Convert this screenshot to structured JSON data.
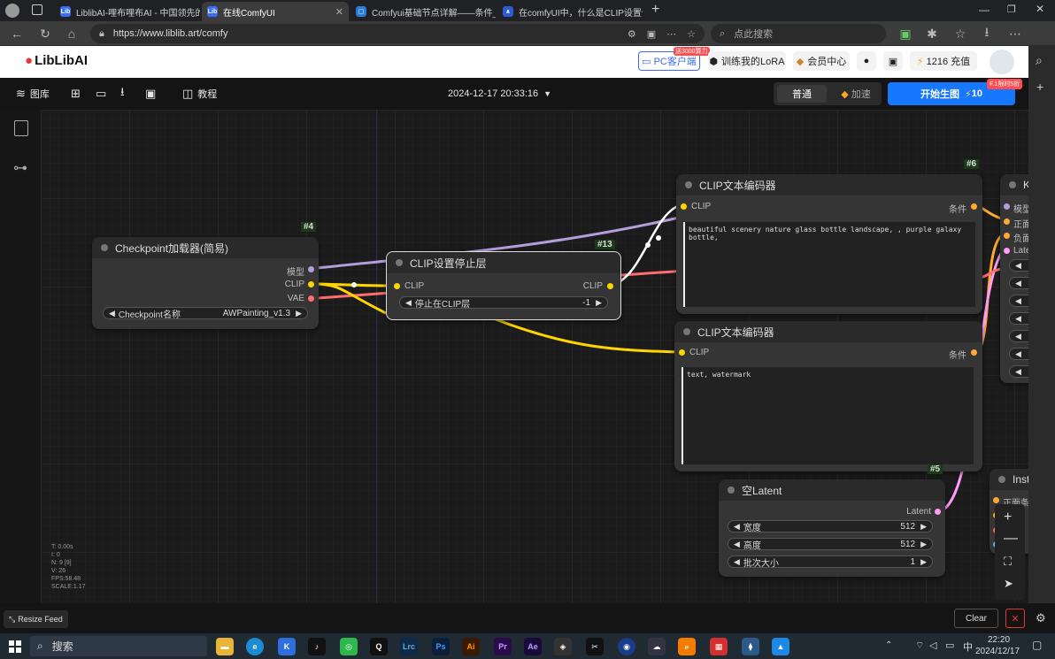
{
  "browser": {
    "tabs": [
      {
        "label": "LiblibAI-哩布哩布AI - 中国领先的"
      },
      {
        "label": "在线ComfyUI"
      },
      {
        "label": "Comfyui基础节点详解——条件_"
      },
      {
        "label": "在comfyUI中，什么是CLIP设置停"
      }
    ],
    "url": "https://www.liblib.art/comfy",
    "search_placeholder": "点此搜索",
    "new_tab": "+"
  },
  "site_header": {
    "logo": "LibLibAI",
    "pc_client": "PC客户端",
    "pc_client_badge": "送3000算力",
    "train_lora": "训练我的LoRA",
    "vip": "会员中心",
    "credits": "1216 充值"
  },
  "toolbar": {
    "gallery": "图库",
    "tutorial": "教程",
    "timestamp": "2024-12-17 20:33:16",
    "mode_normal": "普通",
    "mode_fast": "加速",
    "generate": "开始生图",
    "generate_cost": "10",
    "discount_badge": "F.1限时5折"
  },
  "nodes": {
    "checkpoint": {
      "id": "#4",
      "title": "Checkpoint加载器(简易)",
      "out_model": "模型",
      "out_clip": "CLIP",
      "out_vae": "VAE",
      "widget_label": "Checkpoint名称",
      "widget_value": "AWPainting_v1.3"
    },
    "clip_skip": {
      "id": "#13",
      "title": "CLIP设置停止层",
      "in_clip": "CLIP",
      "out_clip": "CLIP",
      "widget_label": "停止在CLIP层",
      "widget_value": "-1"
    },
    "clip_pos": {
      "id": "#6",
      "title": "CLIP文本编码器",
      "in_clip": "CLIP",
      "out_cond": "条件",
      "text": "beautiful scenery nature glass bottle landscape, , purple galaxy bottle,"
    },
    "clip_neg": {
      "title": "CLIP文本编码器",
      "in_clip": "CLIP",
      "out_cond": "条件",
      "text": "text, watermark"
    },
    "empty_latent": {
      "id": "#5",
      "title": "空Latent",
      "out_latent": "Latent",
      "w_label": "宽度",
      "w_value": "512",
      "h_label": "高度",
      "h_value": "512",
      "b_label": "批次大小",
      "b_value": "1"
    },
    "ksampler": {
      "title": "K",
      "in_model": "模型",
      "in_pos": "正面",
      "in_neg": "负面",
      "in_latent": "Late"
    },
    "instance": {
      "title": "Insta",
      "in_pos": "正面条",
      "in_2": "条"
    }
  },
  "stats": {
    "t": "T: 0.00s",
    "i": "I: 0",
    "n": "N: 9 [9]",
    "v": "V: 26",
    "fps": "FPS:58.48",
    "scale": "SCALE:1.17"
  },
  "bottom": {
    "resize_feed": "Resize Feed",
    "clear": "Clear"
  },
  "taskbar": {
    "search": "搜索",
    "time": "22:20",
    "date": "2024/12/17",
    "lang": "中"
  },
  "colors": {
    "model_wire": "#b39ddb",
    "clip_wire": "#ffd500",
    "vae_wire": "#ff6e6e",
    "cond_wire": "#ffa931",
    "latent_wire": "#ff9cf9",
    "accent": "#1677ff"
  }
}
